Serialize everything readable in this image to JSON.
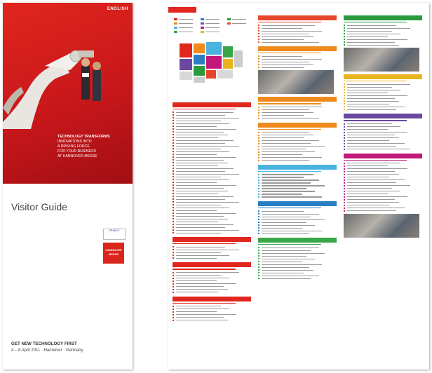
{
  "cover": {
    "language": "ENGLISH",
    "tagline": {
      "headline": "TECHNOLOGY TRANSFORMS",
      "lines": [
        "INNOVATIONS INTO",
        "A DRIVING FORCE",
        "FOR YOUR BUSINESS",
        "AT HANNOVER MESSE"
      ]
    },
    "title": "Visitor Guide",
    "claim": "GET NEW TECHNOLOGY FIRST",
    "dates": "4 – 8 April 2011 · Hannover · Germany",
    "partner_country": "FRANCE",
    "logo_text": "HANNOVER MESSE"
  },
  "spread": {
    "sections": [
      {
        "col": 1,
        "color": "#e0261d",
        "lines": 44,
        "photo": false
      },
      {
        "col": 1,
        "color": "#e0261d",
        "lines": 5,
        "photo": false
      },
      {
        "col": 1,
        "color": "#e0261d",
        "lines": 8,
        "photo": false
      },
      {
        "col": 1,
        "color": "#e0261d",
        "lines": 6,
        "photo": false
      },
      {
        "col": 2,
        "color": "#e8462a",
        "lines": 7,
        "photo": false
      },
      {
        "col": 2,
        "color": "#f08a1c",
        "lines": 5,
        "photo": true
      },
      {
        "col": 2,
        "color": "#f08a1c",
        "lines": 5,
        "photo": false
      },
      {
        "col": 2,
        "color": "#f08a1c",
        "lines": 11,
        "photo": false
      },
      {
        "col": 2,
        "color": "#4ab3e0",
        "lines": 9,
        "photo": false
      },
      {
        "col": 2,
        "color": "#2a7fc4",
        "lines": 9,
        "photo": false
      },
      {
        "col": 2,
        "color": "#3aa64a",
        "lines": 12,
        "photo": false
      },
      {
        "col": 3,
        "color": "#2a9a3c",
        "lines": 8,
        "photo": true
      },
      {
        "col": 3,
        "color": "#e8b41c",
        "lines": 10,
        "photo": false
      },
      {
        "col": 3,
        "color": "#6a4aa0",
        "lines": 10,
        "photo": false
      },
      {
        "col": 3,
        "color": "#c2187a",
        "lines": 18,
        "photo": true
      }
    ]
  }
}
